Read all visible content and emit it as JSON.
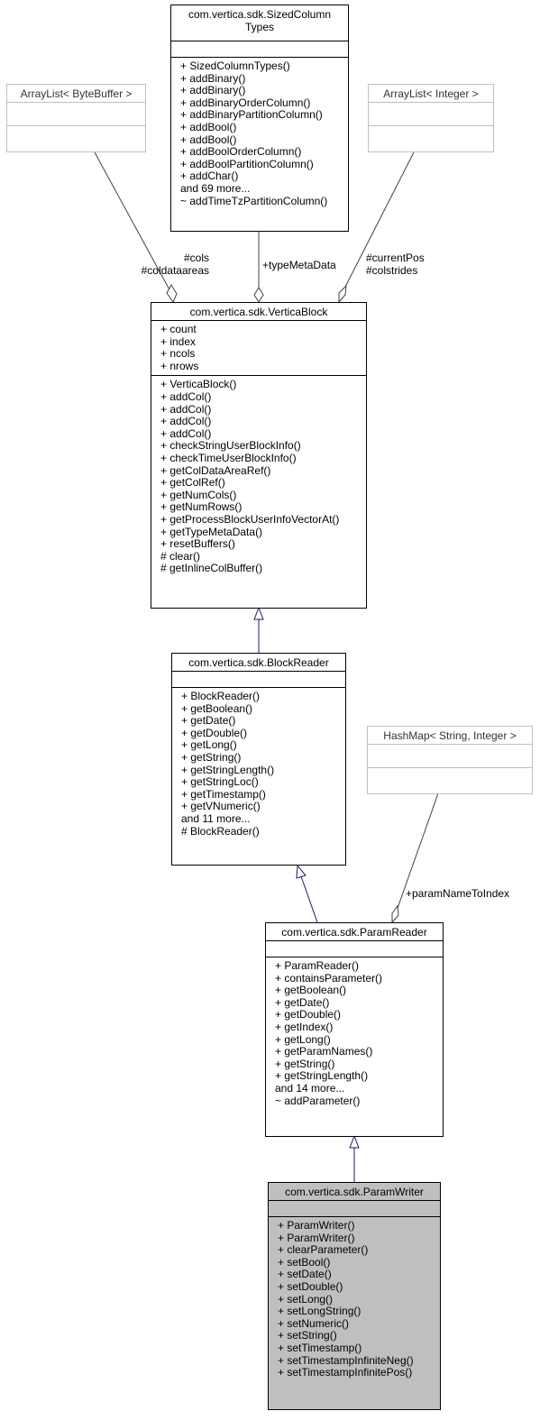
{
  "diagram": {
    "type": "class-inheritance-collaboration",
    "nodes": {
      "sized_column_types": {
        "title": "com.vertica.sdk.SizedColumn\nTypes",
        "attributes": [],
        "methods": [
          "+ SizedColumnTypes()",
          "+ addBinary()",
          "+ addBinary()",
          "+ addBinaryOrderColumn()",
          "+ addBinaryPartitionColumn()",
          "+ addBool()",
          "+ addBool()",
          "+ addBoolOrderColumn()",
          "+ addBoolPartitionColumn()",
          "+ addChar()",
          "and 69 more...",
          "~ addTimeTzPartitionColumn()"
        ]
      },
      "arraylist_bytebuffer": {
        "title": "ArrayList< ByteBuffer >",
        "attributes": [],
        "methods": []
      },
      "arraylist_integer": {
        "title": "ArrayList< Integer >",
        "attributes": [],
        "methods": []
      },
      "vertica_block": {
        "title": "com.vertica.sdk.VerticaBlock",
        "attributes": [
          "+ count",
          "+ index",
          "+ ncols",
          "+ nrows"
        ],
        "methods": [
          "+ VerticaBlock()",
          "+ addCol()",
          "+ addCol()",
          "+ addCol()",
          "+ addCol()",
          "+ checkStringUserBlockInfo()",
          "+ checkTimeUserBlockInfo()",
          "+ getColDataAreaRef()",
          "+ getColRef()",
          "+ getNumCols()",
          "+ getNumRows()",
          "+ getProcessBlockUserInfoVectorAt()",
          "+ getTypeMetaData()",
          "+ resetBuffers()",
          "# clear()",
          "# getInlineColBuffer()"
        ]
      },
      "block_reader": {
        "title": "com.vertica.sdk.BlockReader",
        "attributes": [],
        "methods": [
          "+ BlockReader()",
          "+ getBoolean()",
          "+ getDate()",
          "+ getDouble()",
          "+ getLong()",
          "+ getString()",
          "+ getStringLength()",
          "+ getStringLoc()",
          "+ getTimestamp()",
          "+ getVNumeric()",
          "and 11 more...",
          "# BlockReader()"
        ]
      },
      "hashmap_string_integer": {
        "title": "HashMap< String, Integer >",
        "attributes": [],
        "methods": []
      },
      "param_reader": {
        "title": "com.vertica.sdk.ParamReader",
        "attributes": [],
        "methods": [
          "+ ParamReader()",
          "+ containsParameter()",
          "+ getBoolean()",
          "+ getDate()",
          "+ getDouble()",
          "+ getIndex()",
          "+ getLong()",
          "+ getParamNames()",
          "+ getString()",
          "+ getStringLength()",
          "and 14 more...",
          "~ addParameter()"
        ]
      },
      "param_writer": {
        "title": "com.vertica.sdk.ParamWriter",
        "attributes": [],
        "methods": [
          "+ ParamWriter()",
          "+ ParamWriter()",
          "+ clearParameter()",
          "+ setBool()",
          "+ setDate()",
          "+ setDouble()",
          "+ setLong()",
          "+ setLongString()",
          "+ setNumeric()",
          "+ setString()",
          "+ setTimestamp()",
          "+ setTimestampInfiniteNeg()",
          "+ setTimestampInfinitePos()"
        ]
      }
    },
    "edges": [
      {
        "from": "arraylist_bytebuffer",
        "to": "vertica_block",
        "kind": "aggregation",
        "labels": [
          "#cols",
          "#coldataareas"
        ]
      },
      {
        "from": "sized_column_types",
        "to": "vertica_block",
        "kind": "aggregation",
        "labels": [
          "+typeMetaData"
        ]
      },
      {
        "from": "arraylist_integer",
        "to": "vertica_block",
        "kind": "aggregation",
        "labels": [
          "#currentPos",
          "#colstrides"
        ]
      },
      {
        "from": "vertica_block",
        "to": "block_reader",
        "kind": "inheritance",
        "labels": []
      },
      {
        "from": "block_reader",
        "to": "param_reader",
        "kind": "inheritance",
        "labels": []
      },
      {
        "from": "hashmap_string_integer",
        "to": "param_reader",
        "kind": "aggregation",
        "labels": [
          "+paramNameToIndex"
        ]
      },
      {
        "from": "param_reader",
        "to": "param_writer",
        "kind": "inheritance",
        "labels": []
      }
    ],
    "colors": {
      "inheritance_edge": "#191970",
      "aggregation_edge": "#404040",
      "highlight_fill": "#bfbfbf",
      "external_border": "#bfbfbf"
    }
  }
}
